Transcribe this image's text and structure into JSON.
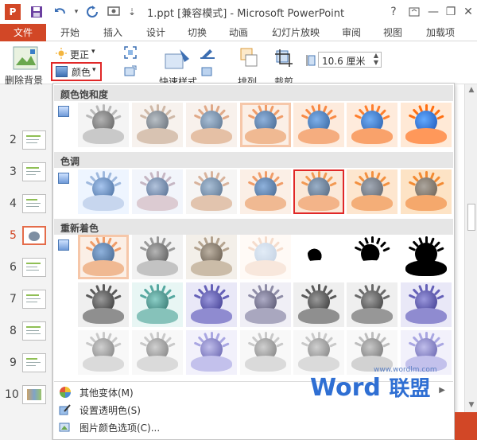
{
  "titlebar": {
    "title": "1.ppt [兼容模式] - Microsoft PowerPoint",
    "help": "?",
    "minimize": "—",
    "restore": "❐",
    "close": "✕"
  },
  "tabs": [
    "文件",
    "开始",
    "插入",
    "设计",
    "切换",
    "动画",
    "幻灯片放映",
    "审阅",
    "视图",
    "加载项"
  ],
  "ribbon": {
    "remove_bg_label": "删除背景",
    "corrections_label": "更正",
    "color_label": "颜色",
    "quick_styles_label": "快速样式",
    "arrange_label": "排列",
    "crop_label": "裁剪",
    "size_value": "10.6 厘米"
  },
  "slides": [
    "2",
    "3",
    "4",
    "5",
    "6",
    "7",
    "8",
    "9",
    "10"
  ],
  "active_slide": "5",
  "gallery": {
    "sections": [
      {
        "title": "颜色饱和度"
      },
      {
        "title": "色调"
      },
      {
        "title": "重新着色"
      }
    ]
  },
  "menu": {
    "more_variations": "其他变体(M)",
    "set_transparent": "设置透明色(S)",
    "color_options": "图片颜色选项(C)..."
  },
  "watermark": {
    "url": "www.wordlm.com",
    "logo_word": "Word",
    "logo_cn": "联盟"
  },
  "colors": {
    "accent": "#d24726",
    "selected_border": "#e02828",
    "highlight_border": "#f6c7a9"
  }
}
